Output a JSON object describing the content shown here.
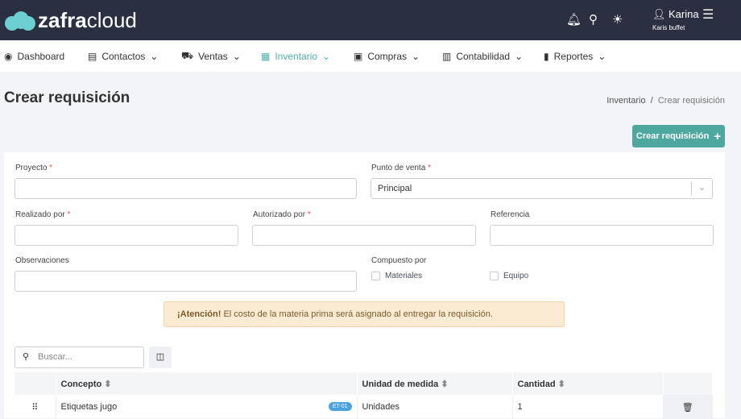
{
  "header": {
    "brand_bold": "zafra",
    "brand_light": "cloud",
    "user_name": "Karina",
    "user_company": "Karis buffet"
  },
  "nav": [
    {
      "label": "Dashboard"
    },
    {
      "label": "Contactos"
    },
    {
      "label": "Ventas"
    },
    {
      "label": "Inventario"
    },
    {
      "label": "Compras"
    },
    {
      "label": "Contabilidad"
    },
    {
      "label": "Reportes"
    }
  ],
  "page": {
    "title": "Crear requisición",
    "breadcrumb": [
      "Inventario",
      "Crear requisición"
    ],
    "create_button": "Crear requisición"
  },
  "form": {
    "proyecto": "Proyecto",
    "punto_venta": "Punto de venta",
    "punto_venta_value": "Principal",
    "realizado": "Realizado por",
    "autorizado": "Autorizado por",
    "referencia": "Referencia",
    "observaciones": "Observaciones",
    "compuesto": "Compuesto por",
    "materiales": "Materiales",
    "equipo": "Equipo",
    "required": "*"
  },
  "alert": {
    "strong": "¡Atención!",
    "text": " El costo de la materia prima será asignado al entregar la requisición."
  },
  "table": {
    "search_placeholder": "Buscar...",
    "columns": [
      "Concepto",
      "Unidad de medida",
      "Cantidad"
    ],
    "rows": [
      {
        "concepto": "Etiquetas jugo",
        "code": "ET-01",
        "unidad": "Unidades",
        "cantidad": "1"
      }
    ]
  }
}
